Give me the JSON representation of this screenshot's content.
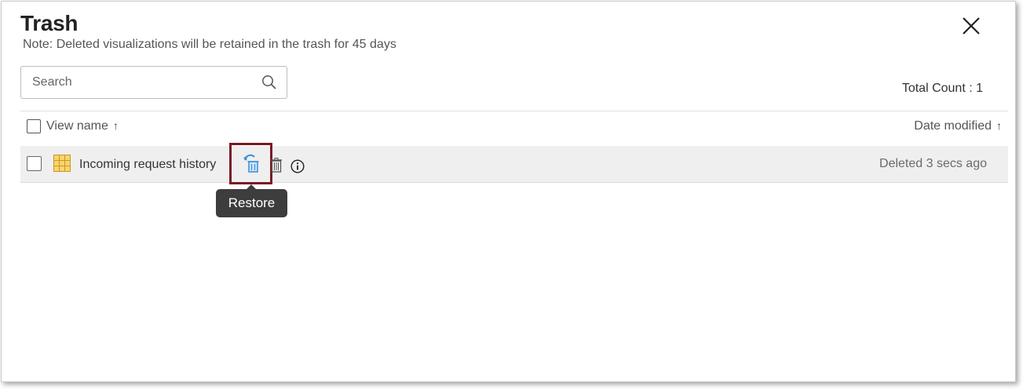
{
  "dialog": {
    "title": "Trash",
    "note": "Note: Deleted visualizations will be retained in the trash for 45 days",
    "close_icon": "close-icon"
  },
  "search": {
    "placeholder": "Search",
    "value": "",
    "icon": "search-icon"
  },
  "total_count": "Total Count : 1",
  "table": {
    "columns": [
      {
        "label": "View name",
        "sort": "↑"
      },
      {
        "label": "Date modified",
        "sort": "↑"
      }
    ],
    "rows": [
      {
        "name": "Incoming request history",
        "type_icon": "table-view-icon",
        "deleted": "Deleted 3 secs ago",
        "actions": [
          "restore-icon",
          "delete-icon",
          "info-icon"
        ]
      }
    ]
  },
  "tooltip": "Restore",
  "colors": {
    "highlight_border": "#7a1a26",
    "row_bg": "#efefef",
    "tooltip_bg": "#3d3d3d",
    "restore_icon": "#3a8fd6",
    "table_icon": "#e9b73a"
  }
}
